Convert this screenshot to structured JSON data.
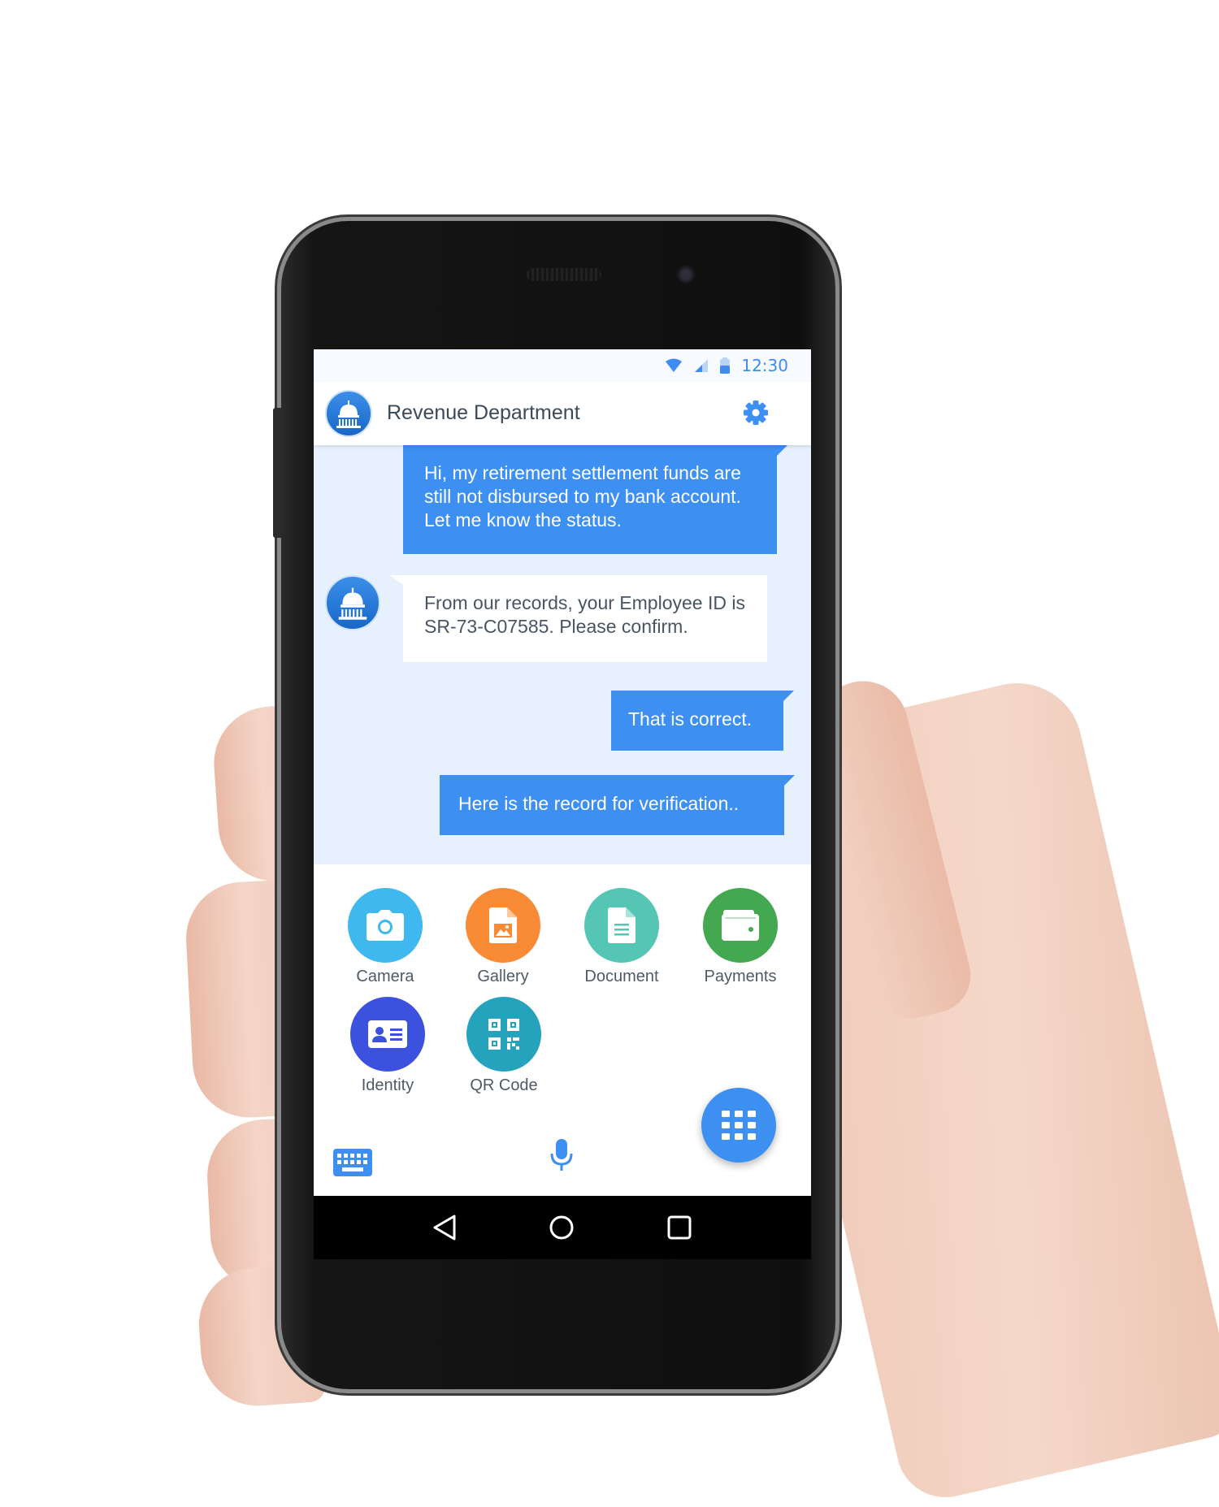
{
  "status_bar": {
    "time": "12:30"
  },
  "header": {
    "title": "Revenue Department",
    "icons": {
      "avatar": "capitol-dome-icon",
      "settings": "gear-icon"
    }
  },
  "chat": {
    "messages": [
      {
        "from": "user",
        "text": "Hi, my retirement settlement funds are still not disbursed to my bank account. Let me know the status."
      },
      {
        "from": "bot",
        "text": "From our records, your Employee ID is SR-73-C07585. Please confirm."
      },
      {
        "from": "user",
        "text": "That is correct."
      },
      {
        "from": "user",
        "text": "Here is the record for verification.."
      }
    ]
  },
  "attachments": [
    {
      "label": "Camera",
      "icon": "camera-icon",
      "color": "#3fb8ef"
    },
    {
      "label": "Gallery",
      "icon": "image-file-icon",
      "color": "#f98a36"
    },
    {
      "label": "Document",
      "icon": "document-icon",
      "color": "#55c6b3"
    },
    {
      "label": "Payments",
      "icon": "wallet-icon",
      "color": "#43a850"
    },
    {
      "label": "Identity",
      "icon": "id-card-icon",
      "color": "#3c52df"
    },
    {
      "label": "QR Code",
      "icon": "qr-code-icon",
      "color": "#26a3bc"
    }
  ],
  "input_bar": {
    "icons": [
      "keyboard-icon",
      "microphone-icon",
      "grid-menu-icon"
    ]
  },
  "nav_bar": {
    "icons": [
      "back-icon",
      "home-icon",
      "recents-icon"
    ]
  },
  "colors": {
    "accent": "#3d8ff2",
    "chat_background": "#e7f1fe",
    "header_text": "#3b4a5a"
  }
}
